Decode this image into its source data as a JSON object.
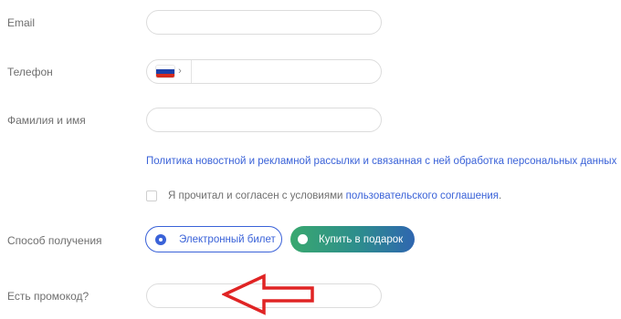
{
  "form": {
    "email_label": "Email",
    "email_value": "",
    "phone_label": "Телефон",
    "phone_value": "",
    "phone_country_chevron": "›",
    "name_label": "Фамилия и имя",
    "name_value": "",
    "policy_link_text": "Политика новостной и рекламной рассылки и связанная с ней обработка персональных данных",
    "agree_text": "Я прочитал и согласен с условиями",
    "agree_link_text": "пользовательского соглашения",
    "agree_suffix": ".",
    "delivery_label": "Способ получения",
    "delivery_options": [
      {
        "label": "Электронный билет",
        "selected": true
      },
      {
        "label": "Купить в подарок",
        "selected": false
      }
    ],
    "promo_label": "Есть промокод?",
    "promo_value": ""
  },
  "colors": {
    "accent": "#3a62d8",
    "annotation_arrow": "#e02424",
    "flag_white": "#ffffff",
    "flag_blue": "#1c3fa8",
    "flag_red": "#d52b1e"
  },
  "icons": {
    "country_flag": "russia-flag-icon",
    "annotation": "left-arrow-icon"
  }
}
